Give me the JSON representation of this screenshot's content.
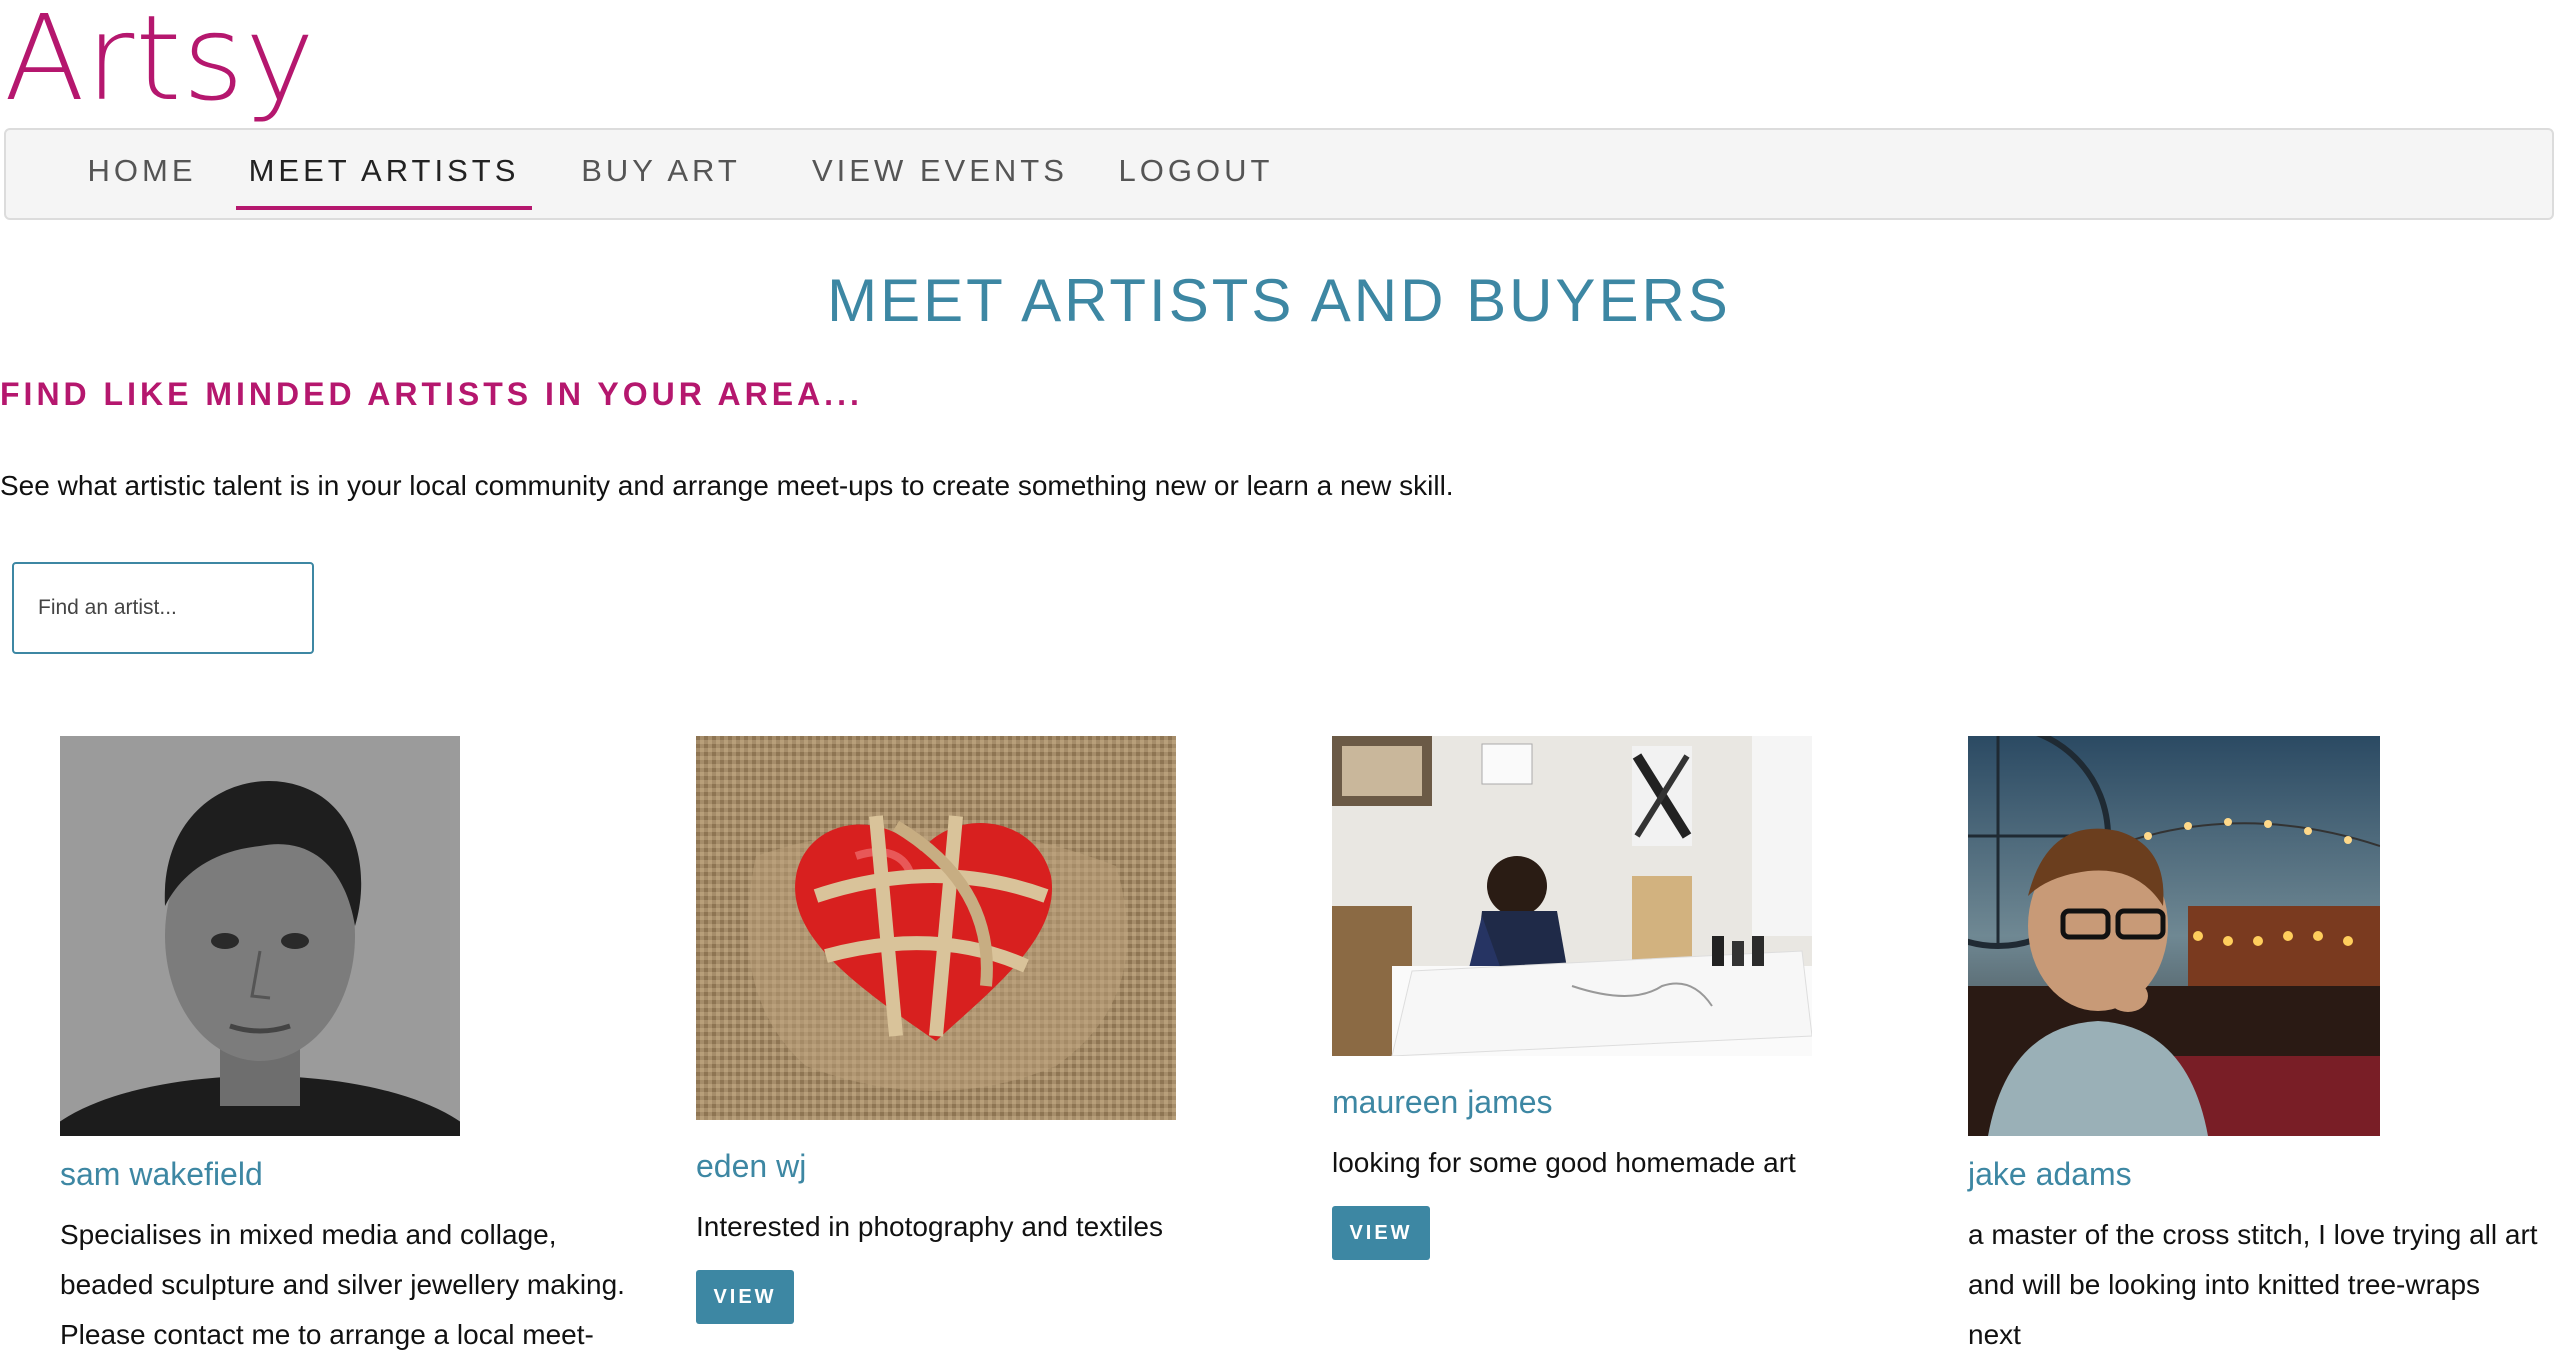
{
  "brand": {
    "logo_text": "Artsy",
    "accent_color": "#b5176e",
    "primary_color": "#3d87a3"
  },
  "nav": {
    "items": [
      {
        "label": "HOME",
        "active": false
      },
      {
        "label": "MEET ARTISTS",
        "active": true
      },
      {
        "label": "BUY ART",
        "active": false
      },
      {
        "label": "VIEW EVENTS",
        "active": false
      },
      {
        "label": "LOGOUT",
        "active": false
      }
    ]
  },
  "main": {
    "title": "MEET ARTISTS AND BUYERS",
    "subtitle": "FIND LIKE MINDED ARTISTS IN YOUR AREA...",
    "intro": "See what artistic talent is in your local community and arrange meet-ups to create something new or learn a new skill.",
    "search_placeholder": "Find an artist..."
  },
  "artists": [
    {
      "name": "sam wakefield",
      "desc_lines": [
        "Specialises in mixed media and collage,",
        "beaded sculpture and silver jewellery making.",
        "Please contact me to arrange a local meet-"
      ],
      "image": "portrait-photo"
    },
    {
      "name": "eden wj",
      "desc_lines": [
        "Interested in photography and textiles"
      ],
      "button": "VIEW",
      "image": "red-heart-rope-photo"
    },
    {
      "name": "maureen james",
      "desc_lines": [
        "looking for some good homemade art"
      ],
      "button": "VIEW",
      "image": "studio-drawing-photo"
    },
    {
      "name": "jake adams",
      "desc_lines": [
        "a master of the cross stitch, I love trying all art",
        "and will be looking into knitted tree-wraps",
        "next"
      ],
      "image": "fairground-portrait-photo"
    }
  ]
}
